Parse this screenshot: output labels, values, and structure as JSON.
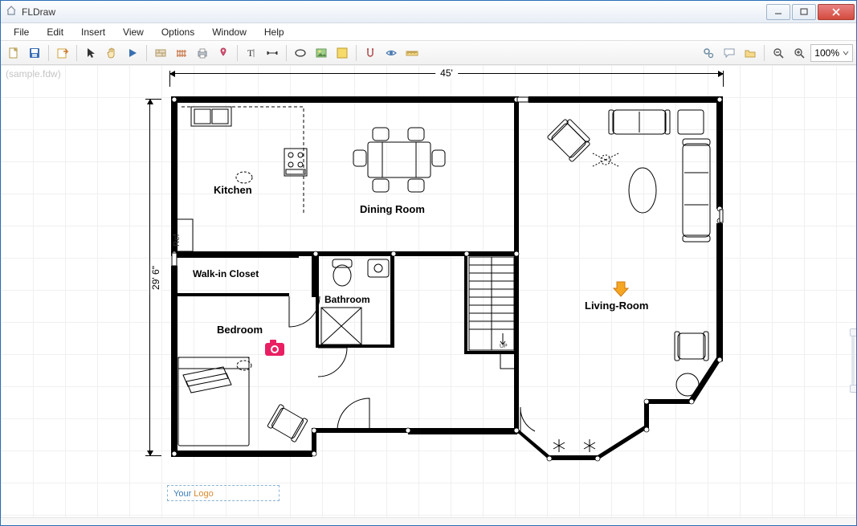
{
  "window": {
    "title": "FLDraw"
  },
  "menu": {
    "items": [
      "File",
      "Edit",
      "Insert",
      "View",
      "Options",
      "Window",
      "Help"
    ]
  },
  "toolbar": {
    "zoom_value": "100%"
  },
  "canvas": {
    "filename_watermark": "(sample.fdw)",
    "yourlogo_1": "Your",
    "yourlogo_2": "Logo"
  },
  "plan": {
    "dim_top": "45'",
    "dim_left": "29' 6\"",
    "rooms": {
      "kitchen": "Kitchen",
      "dining": "Dining Room",
      "living": "Living-Room",
      "closet": "Walk-in Closet",
      "bathroom": "Bathroom",
      "bedroom": "Bedroom",
      "ref": "Ref",
      "up": "UP"
    }
  }
}
